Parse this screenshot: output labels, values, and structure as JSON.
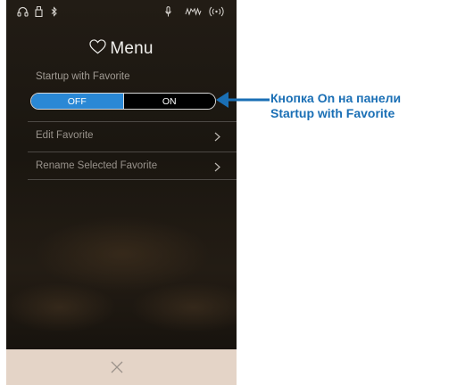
{
  "menu": {
    "title": "Menu",
    "section_label": "Startup with Favorite",
    "toggle": {
      "off_label": "OFF",
      "on_label": "ON",
      "selected": "ON"
    },
    "items": [
      {
        "label": "Edit Favorite"
      },
      {
        "label": "Rename Selected Favorite"
      }
    ]
  },
  "statusbar": {
    "icons": [
      "headphones-icon",
      "usb-icon",
      "bluetooth-icon",
      "mic-icon",
      "waveform-icon",
      "wireless-icon"
    ]
  },
  "callout": {
    "line1": "Кнопка On на панели",
    "line2": "Startup with Favorite"
  },
  "colors": {
    "accent": "#2a88d5",
    "callout": "#1a6fb5",
    "bottom_bar": "#e4d4c7"
  }
}
